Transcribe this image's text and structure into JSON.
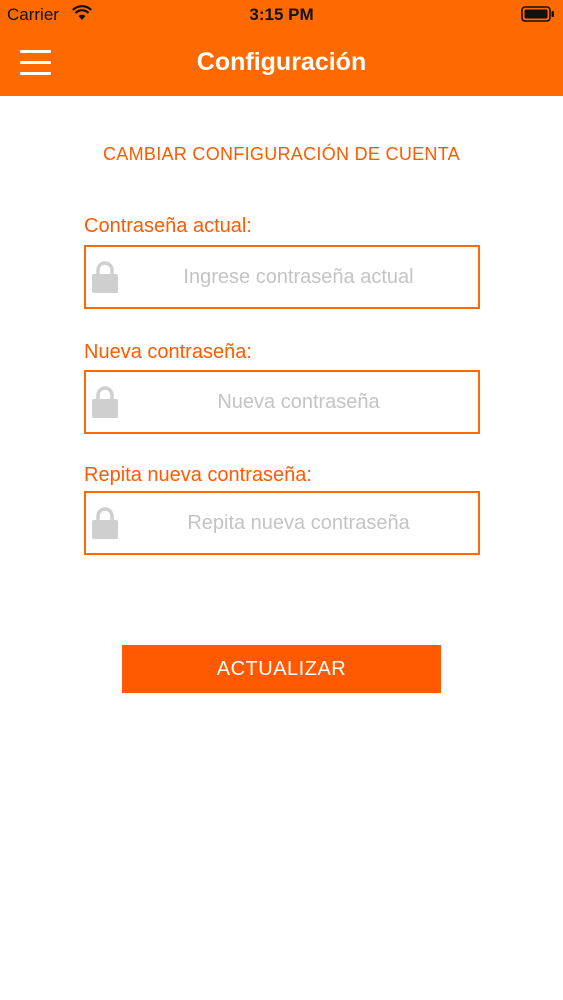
{
  "status_bar": {
    "carrier": "Carrier",
    "time": "3:15 PM"
  },
  "header": {
    "title": "Configuración",
    "menu_icon": "hamburger-menu-icon",
    "background_color": "#ff6a00"
  },
  "form": {
    "section_title": "CAMBIAR CONFIGURACIÓN DE CUENTA",
    "fields": [
      {
        "label": "Contraseña actual:",
        "placeholder": "Ingrese contraseña actual",
        "value": "",
        "icon": "lock-icon"
      },
      {
        "label": "Nueva contraseña:",
        "placeholder": "Nueva contraseña",
        "value": "",
        "icon": "lock-icon"
      },
      {
        "label": "Repita nueva contraseña:",
        "placeholder": "Repita nueva contraseña",
        "value": "",
        "icon": "lock-icon"
      }
    ],
    "submit_label": "ACTUALIZAR",
    "accent_color": "#ff5a00"
  }
}
